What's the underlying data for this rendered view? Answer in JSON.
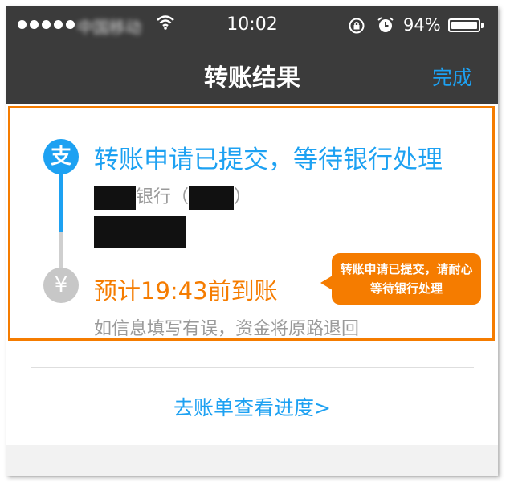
{
  "status_bar": {
    "carrier": "中国移动",
    "time": "10:02",
    "battery_percent": "94%",
    "battery_level": 0.94,
    "icons": [
      "signal-dots-icon",
      "wifi-icon",
      "rotation-lock-icon",
      "alarm-icon",
      "battery-icon"
    ]
  },
  "nav": {
    "title": "转账结果",
    "done_label": "完成"
  },
  "result": {
    "status_title": "转账申请已提交，等待银行处理",
    "bank_label": "银行（",
    "bank_suffix": "）",
    "eta": "预计19:43前到账",
    "note": "如信息填写有误，资金将原路退回",
    "step1_icon": "支",
    "step2_icon": "¥"
  },
  "callout": {
    "text": "转账申请已提交，请耐心等待银行处理"
  },
  "footer": {
    "progress_link": "去账单查看进度>"
  },
  "colors": {
    "accent_blue": "#1da1f2",
    "highlight_orange": "#f57c00",
    "bar_dark": "#3b3b3b"
  }
}
